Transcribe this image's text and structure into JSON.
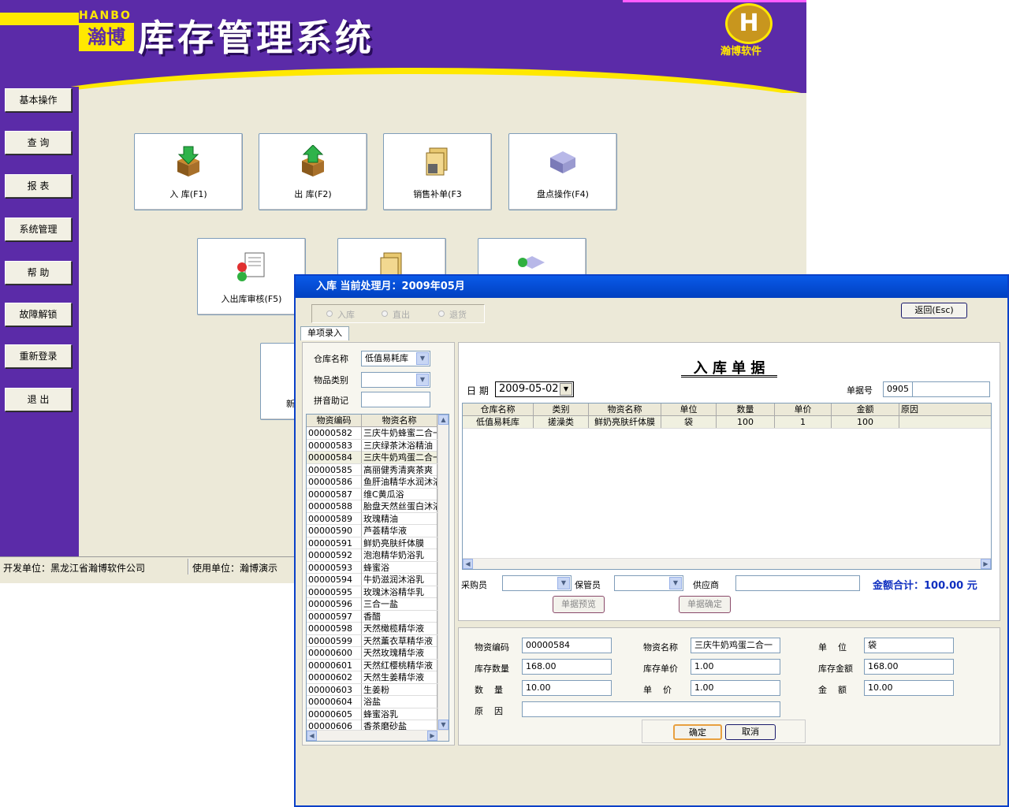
{
  "app": {
    "brand_latin": "HANBO",
    "brand_cn": "瀚博",
    "title": "库存管理系统",
    "logo_text": "瀚博软件",
    "accent": "#5b2ba8",
    "yellow": "#ffe800"
  },
  "sidebar": {
    "items": [
      {
        "label": "基本操作"
      },
      {
        "label": "查  询"
      },
      {
        "label": "报  表"
      },
      {
        "label": "系统管理"
      },
      {
        "label": "帮  助"
      },
      {
        "label": "故障解锁"
      },
      {
        "label": "重新登录"
      },
      {
        "label": "退  出"
      }
    ]
  },
  "main": {
    "buttons": [
      {
        "label": "入  库(F1)",
        "icon": "box-in-icon"
      },
      {
        "label": "出  库(F2)",
        "icon": "box-out-icon"
      },
      {
        "label": "销售补单(F3",
        "icon": "folder-icon"
      },
      {
        "label": "盘点操作(F4)",
        "icon": "stack-icon"
      },
      {
        "label": "入出库审核(F5)",
        "icon": "audit-doc-icon"
      },
      {
        "label": "",
        "icon": "folder-icon"
      },
      {
        "label": "",
        "icon": "stack-check-icon"
      },
      {
        "label": "新",
        "icon": ""
      }
    ]
  },
  "status": {
    "developer": "开发单位：黑龙江省瀚博软件公司",
    "user": "使用单位：瀚博演示"
  },
  "dialog": {
    "title": "入库   当前处理月：2009年05月",
    "radios": [
      "入库",
      "直出",
      "退货"
    ],
    "return_button": "返回(Esc)",
    "tab": "单项录入",
    "warehouse_label": "仓库名称",
    "warehouse_value": "低值易耗库",
    "category_label": "物品类别",
    "category_value": "",
    "pinyin_label": "拼音助记",
    "pinyin_value": "",
    "list": {
      "headers": [
        "物资编码",
        "物资名称"
      ],
      "rows": [
        [
          "00000582",
          "三庆牛奶蜂蜜二合一"
        ],
        [
          "00000583",
          "三庆绿茶沐浴精油"
        ],
        [
          "00000584",
          "三庆牛奶鸡蛋二合一"
        ],
        [
          "00000585",
          "高丽健秀清爽茶爽"
        ],
        [
          "00000586",
          "鱼肝油精华水润沐浴"
        ],
        [
          "00000587",
          "维C黄瓜浴"
        ],
        [
          "00000588",
          "胎盘天然丝蛋白沐浴"
        ],
        [
          "00000589",
          "玫瑰精油"
        ],
        [
          "00000590",
          "芦荟精华液"
        ],
        [
          "00000591",
          "鲜奶亮肤纤体膜"
        ],
        [
          "00000592",
          "泡泡精华奶浴乳"
        ],
        [
          "00000593",
          "蜂蜜浴"
        ],
        [
          "00000594",
          "牛奶滋润沐浴乳"
        ],
        [
          "00000595",
          "玫瑰沐浴精华乳"
        ],
        [
          "00000596",
          "三合一盐"
        ],
        [
          "00000597",
          "香醋"
        ],
        [
          "00000598",
          "天然橄榄精华液"
        ],
        [
          "00000599",
          "天然薰衣草精华液"
        ],
        [
          "00000600",
          "天然玫瑰精华液"
        ],
        [
          "00000601",
          "天然红樱桃精华液"
        ],
        [
          "00000602",
          "天然生姜精华液"
        ],
        [
          "00000603",
          "生姜粉"
        ],
        [
          "00000604",
          "浴盐"
        ],
        [
          "00000605",
          "蜂蜜浴乳"
        ],
        [
          "00000606",
          "香茶磨砂盐"
        ]
      ]
    },
    "doc": {
      "title": "入 库 单 据",
      "date_label": "日 期",
      "date_value": "2009-05-02",
      "docno_label": "单据号",
      "docno_value": "0905",
      "headers": [
        "仓库名称",
        "类别",
        "物资名称",
        "单位",
        "数量",
        "单价",
        "金额",
        "原因"
      ],
      "rows": [
        [
          "低值易耗库",
          "搓澡类",
          "鲜奶亮肤纤体膜",
          "袋",
          "100",
          "1",
          "100",
          ""
        ]
      ],
      "buyer_label": "采购员",
      "keeper_label": "保管员",
      "supplier_label": "供应商",
      "total_label": "金额合计：100.00 元",
      "preview_button": "单据预览",
      "confirm_doc_button": "单据确定"
    },
    "detail": {
      "code_label": "物资编码",
      "code_value": "00000584",
      "name_label": "物资名称",
      "name_value": "三庆牛奶鸡蛋二合一",
      "unit_label": "单    位",
      "unit_value": "袋",
      "stock_qty_label": "库存数量",
      "stock_qty_value": "168.00",
      "stock_price_label": "库存单价",
      "stock_price_value": "1.00",
      "stock_amount_label": "库存金额",
      "stock_amount_value": "168.00",
      "qty_label": "数    量",
      "qty_value": "10.00",
      "price_label": "单    价",
      "price_value": "1.00",
      "amount_label": "金    额",
      "amount_value": "10.00",
      "reason_label": "原    因",
      "reason_value": "",
      "ok_button": "确定",
      "cancel_button": "取消"
    }
  }
}
